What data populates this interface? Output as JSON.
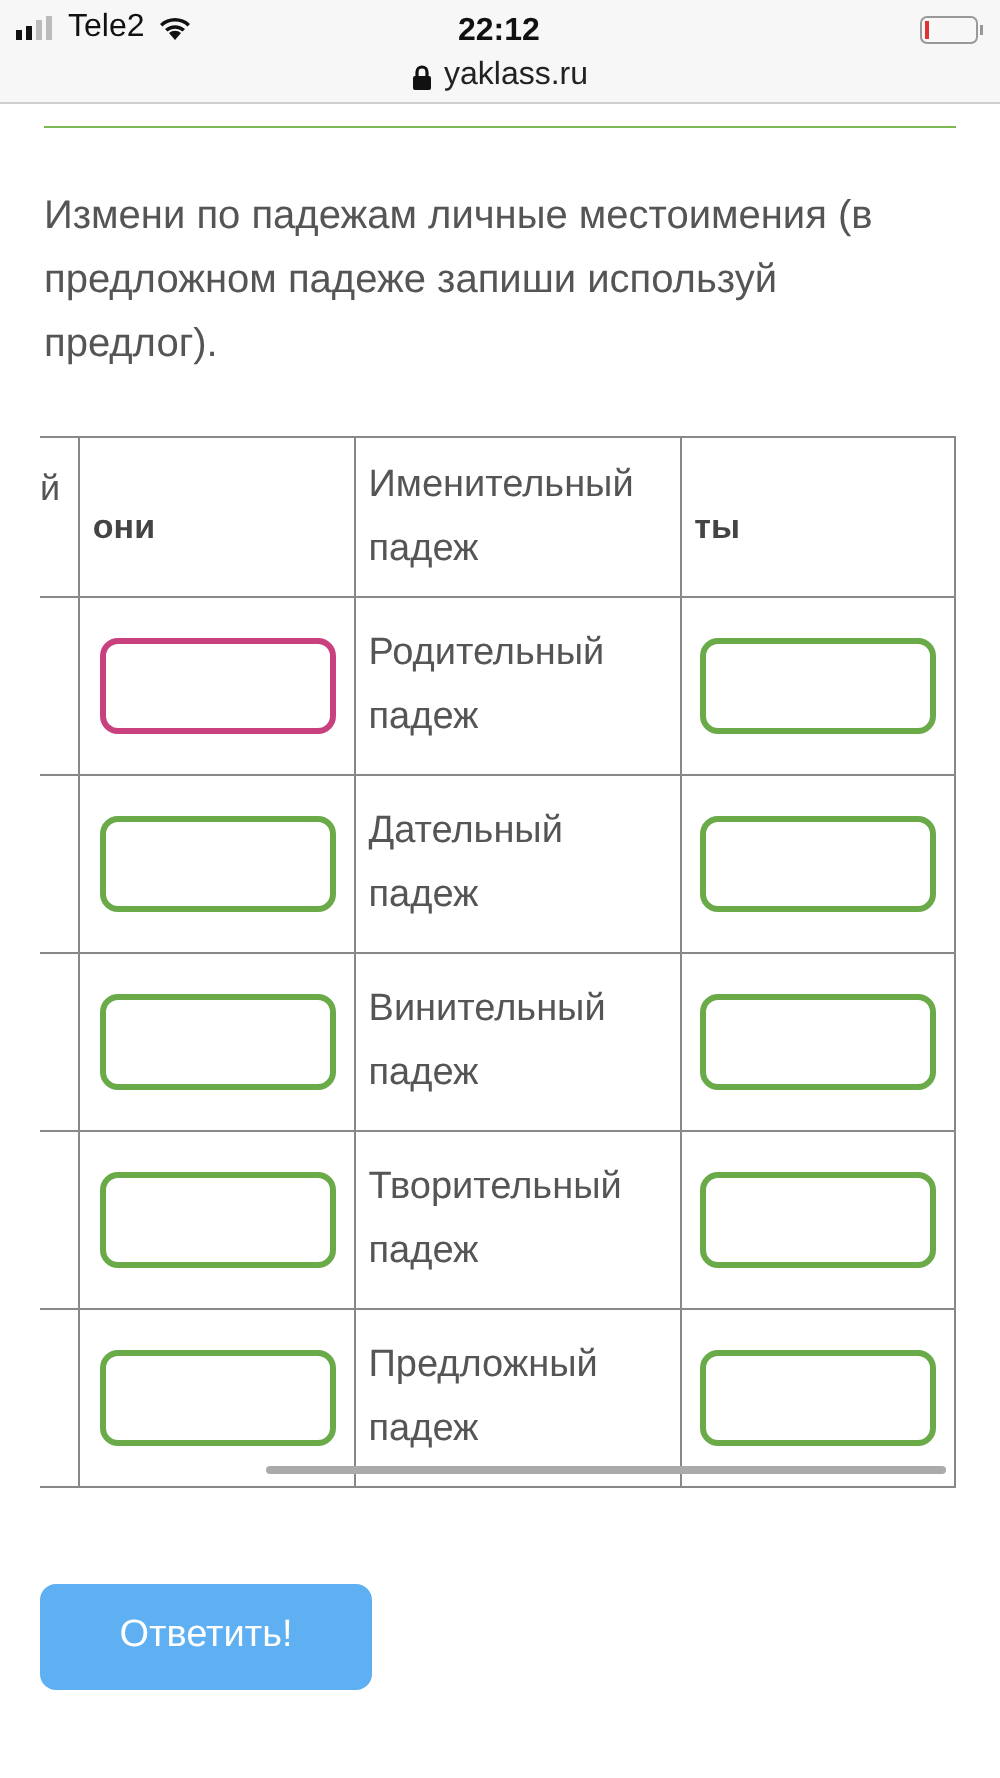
{
  "status_bar": {
    "carrier": "Tele2",
    "time": "22:12"
  },
  "address_bar": {
    "url": "yaklass.ru"
  },
  "task": {
    "text": "Измени по падежам личные местоимения (в предложном падеже запиши используй предлог)."
  },
  "table": {
    "columns": [
      "й",
      "они",
      "Именительный падеж",
      "ты"
    ],
    "rows": [
      {
        "case": "Родительный падеж",
        "fields": [
          {
            "color": "#c8407e"
          },
          {
            "color": "#6aaa48"
          }
        ]
      },
      {
        "case": "Дательный падеж",
        "fields": [
          {
            "color": "#6aaa48"
          },
          {
            "color": "#6aaa48"
          }
        ]
      },
      {
        "case": "Винительный падеж",
        "fields": [
          {
            "color": "#6aaa48"
          },
          {
            "color": "#6aaa48"
          }
        ]
      },
      {
        "case": "Творительный падеж",
        "fields": [
          {
            "color": "#6aaa48"
          },
          {
            "color": "#6aaa48"
          }
        ]
      },
      {
        "case": "Предложный падеж",
        "fields": [
          {
            "color": "#6aaa48"
          },
          {
            "color": "#6aaa48"
          }
        ]
      }
    ]
  },
  "submit_button": {
    "label": "Ответить!"
  }
}
